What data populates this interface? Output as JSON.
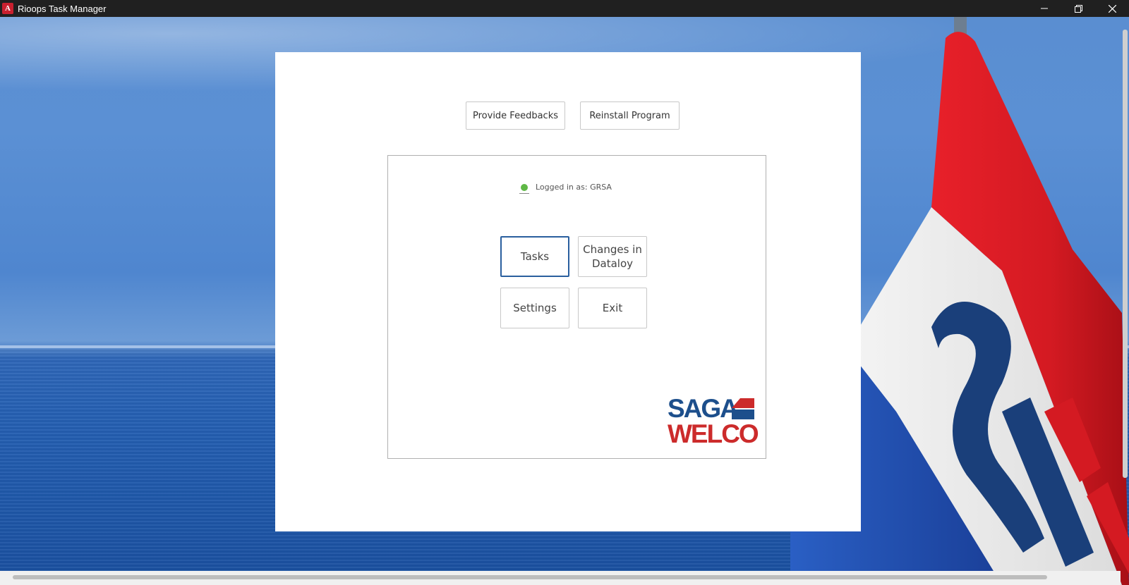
{
  "window": {
    "title": "Rioops Task Manager",
    "app_icon_letter": "A"
  },
  "top_buttons": {
    "feedback_label": "Provide Feedbacks",
    "reinstall_label": "Reinstall Program"
  },
  "status": {
    "logged_in_text": "Logged in as: GRSA",
    "indicator_color": "#5fb846"
  },
  "menu": {
    "tasks_label": "Tasks",
    "changes_label": "Changes in Dataloy",
    "settings_label": "Settings",
    "exit_label": "Exit"
  },
  "logo": {
    "line1": "SAGA",
    "line2": "WELCO",
    "colors": {
      "navy": "#1d4f8c",
      "red": "#cc2b2b"
    }
  },
  "background": {
    "flag_letters": "SW"
  }
}
